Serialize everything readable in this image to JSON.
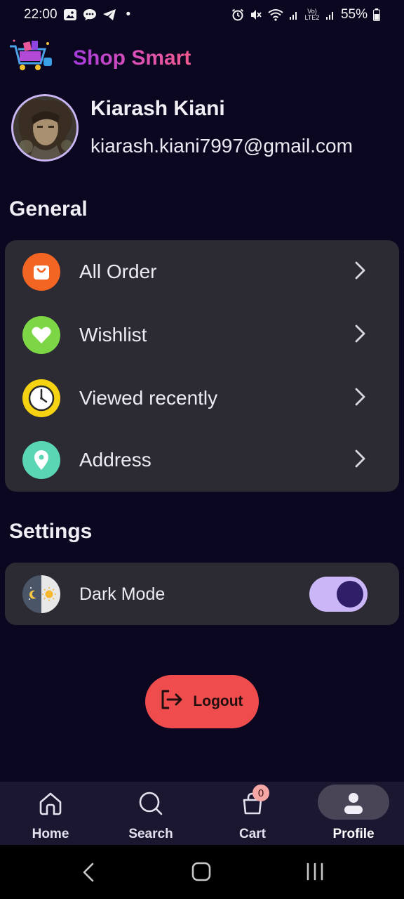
{
  "status_bar": {
    "time": "22:00",
    "dot": "•",
    "battery": "55%",
    "network": "Vo) LTE2"
  },
  "app": {
    "title": "Shop Smart",
    "logo_icon": "shopping-cart-logo"
  },
  "profile": {
    "name": "Kiarash Kiani",
    "email": "kiarash.kiani7997@gmail.com"
  },
  "general": {
    "title": "General",
    "items": [
      {
        "label": "All Order",
        "icon": "shopping-bag-icon",
        "color": "#f26522"
      },
      {
        "label": "Wishlist",
        "icon": "heart-icon",
        "color": "#7cd645"
      },
      {
        "label": "Viewed recently",
        "icon": "clock-icon",
        "color": "#f5d312"
      },
      {
        "label": "Address",
        "icon": "location-pin-icon",
        "color": "#5ad6b4"
      }
    ]
  },
  "settings": {
    "title": "Settings",
    "dark_mode": {
      "label": "Dark Mode",
      "enabled": true,
      "icon": "day-night-icon"
    }
  },
  "logout": {
    "label": "Logout"
  },
  "bottom_nav": {
    "items": [
      {
        "label": "Home",
        "icon": "home-icon",
        "active": false
      },
      {
        "label": "Search",
        "icon": "search-icon",
        "active": false
      },
      {
        "label": "Cart",
        "icon": "cart-bag-icon",
        "active": false
      },
      {
        "label": "Profile",
        "icon": "profile-icon",
        "active": true
      }
    ],
    "cart_badge": "0"
  },
  "colors": {
    "background": "#0c0720",
    "card": "#2c2a33",
    "accent": "#cbb6f7",
    "logout": "#ef4c4d"
  }
}
